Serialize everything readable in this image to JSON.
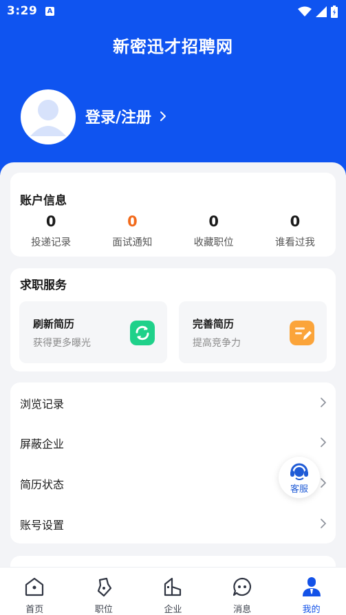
{
  "status_bar": {
    "time": "3:29",
    "notification_glyph": "A"
  },
  "header": {
    "title": "新密迅才招聘网",
    "login_label": "登录/注册"
  },
  "account": {
    "title": "账户信息",
    "stats": [
      {
        "value": "0",
        "label": "投递记录"
      },
      {
        "value": "0",
        "label": "面试通知"
      },
      {
        "value": "0",
        "label": "收藏职位"
      },
      {
        "value": "0",
        "label": "谁看过我"
      }
    ]
  },
  "services": {
    "title": "求职服务",
    "tiles": [
      {
        "title": "刷新简历",
        "subtitle": "获得更多曝光",
        "icon": "refresh-icon",
        "color": "#1fd18a"
      },
      {
        "title": "完善简历",
        "subtitle": "提高竞争力",
        "icon": "edit-note-icon",
        "color": "#fba43a"
      }
    ]
  },
  "menu": {
    "items": [
      {
        "label": "浏览记录"
      },
      {
        "label": "屏蔽企业"
      },
      {
        "label": "简历状态"
      },
      {
        "label": "账号设置"
      }
    ]
  },
  "customer_service": {
    "label": "客服"
  },
  "tabbar": {
    "items": [
      {
        "label": "首页",
        "icon": "home-icon"
      },
      {
        "label": "职位",
        "icon": "briefcase-icon"
      },
      {
        "label": "企业",
        "icon": "building-icon"
      },
      {
        "label": "消息",
        "icon": "message-icon"
      },
      {
        "label": "我的",
        "icon": "profile-icon"
      }
    ],
    "active_index": 4
  },
  "colors": {
    "brand_blue": "#0f54f0",
    "highlight_orange": "#f26a1b",
    "page_background": "#f3f4f7"
  }
}
